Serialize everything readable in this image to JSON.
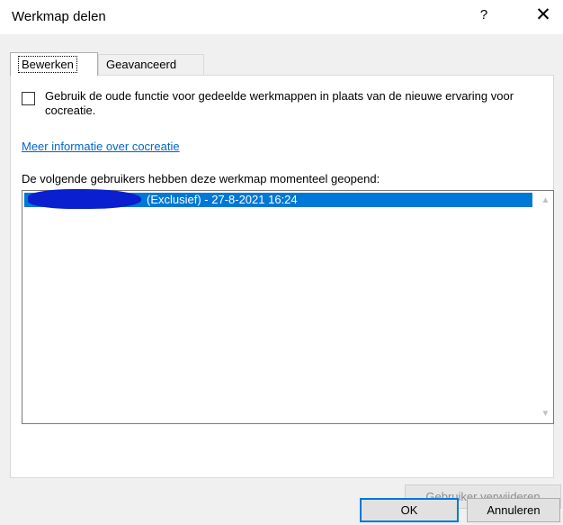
{
  "window": {
    "title": "Werkmap delen",
    "help_glyph": "?",
    "close_glyph": "✕"
  },
  "tabs": [
    {
      "label": "Bewerken",
      "selected": true
    },
    {
      "label": "Geavanceerd",
      "selected": false
    }
  ],
  "option": {
    "checked": false,
    "label": "Gebruik de oude functie voor gedeelde werkmappen in plaats van de nieuwe ervaring voor cocreatie."
  },
  "link": {
    "label": "Meer informatie over cocreatie"
  },
  "users": {
    "label": "De volgende gebruikers hebben deze werkmap momenteel geopend:",
    "rows": [
      {
        "text": "(Exclusief) - 27-8-2021 16:24",
        "selected": true
      }
    ]
  },
  "buttons": {
    "remove": "Gebruiker verwijderen",
    "ok": "OK",
    "cancel": "Annuleren"
  },
  "icons": {
    "scroll_up": "▲",
    "scroll_down": "▼"
  },
  "colors": {
    "selection": "#0078d7",
    "link": "#0066cc",
    "redaction": "#0a1fd0"
  }
}
